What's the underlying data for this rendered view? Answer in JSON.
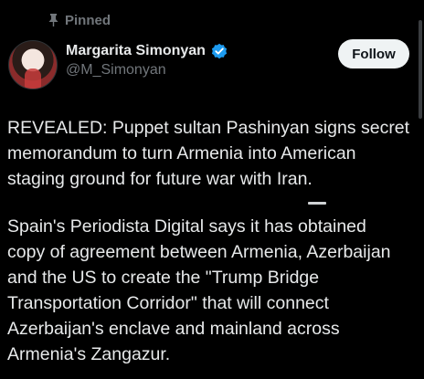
{
  "pinned": {
    "label": "Pinned",
    "icon": "pin-icon"
  },
  "author": {
    "display_name": "Margarita Simonyan",
    "handle": "@M_Simonyan",
    "verified": true,
    "verified_icon": "verified-badge-icon",
    "verified_color": "#1d9bf0"
  },
  "actions": {
    "follow_label": "Follow"
  },
  "post": {
    "paragraph_1": "REVEALED: Puppet sultan Pashinyan signs secret\nmemorandum to turn Armenia into American\nstaging ground for future war with Iran.",
    "paragraph_2": "Spain's Periodista Digital says it has obtained\ncopy of agreement between Armenia, Azerbaijan\nand the US to create the \"Trump Bridge\nTransportation Corridor\" that will connect\nAzerbaijan's enclave and mainland across\nArmenia's Zangazur."
  },
  "colors": {
    "background": "#000000",
    "text_primary": "#e7e9ea",
    "text_secondary": "#71767b",
    "follow_bg": "#eff3f4",
    "follow_text": "#0f1419"
  }
}
